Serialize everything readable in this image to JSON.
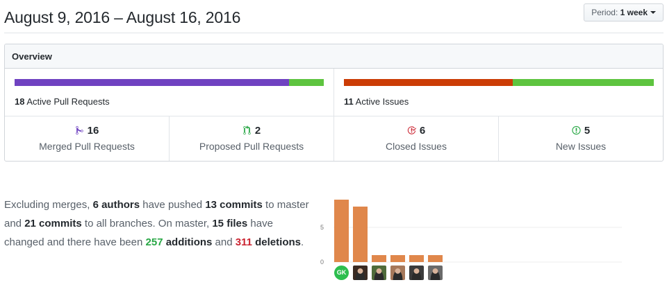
{
  "header": {
    "title": "August 9, 2016 – August 16, 2016",
    "period_prefix": "Period:",
    "period_value": "1 week"
  },
  "overview": {
    "title": "Overview",
    "pull_requests_bar": {
      "merged_fraction": 0.888,
      "color_merged": "#6f42c1",
      "color_open": "#5ec43f"
    },
    "issues_bar": {
      "closed_fraction": 0.545,
      "color_closed": "#cb3c05",
      "color_open": "#5ec43f"
    },
    "active_pull_requests": {
      "count": "18",
      "label": "Active Pull Requests"
    },
    "active_issues": {
      "count": "11",
      "label": "Active Issues"
    },
    "stats": [
      {
        "count": "16",
        "label": "Merged Pull Requests",
        "icon": "git-merge-icon",
        "icon_color": "#6f42c1"
      },
      {
        "count": "2",
        "label": "Proposed Pull Requests",
        "icon": "git-pull-request-icon",
        "icon_color": "#28a745"
      },
      {
        "count": "6",
        "label": "Closed Issues",
        "icon": "issue-closed-icon",
        "icon_color": "#cb2431"
      },
      {
        "count": "5",
        "label": "New Issues",
        "icon": "issue-opened-icon",
        "icon_color": "#28a745"
      }
    ]
  },
  "commit_summary": {
    "t1": "Excluding merges, ",
    "authors": "6 authors",
    "t2": " have pushed ",
    "commits_master": "13 commits",
    "t3": " to master and ",
    "commits_all": "21 commits",
    "t4": " to all branches. On master, ",
    "files": "15 files",
    "t5": " have changed and there have been ",
    "additions_count": "257",
    "additions_word": " additions",
    "t6": " and ",
    "deletions_count": "311",
    "deletions_word": " deletions",
    "t7": "."
  },
  "chart_data": {
    "type": "bar",
    "categories": [
      "GK",
      "author-2",
      "author-3",
      "author-4",
      "author-5",
      "author-6"
    ],
    "values": [
      9,
      8,
      1,
      1,
      1,
      1
    ],
    "ylim": [
      0,
      10
    ],
    "yticks": [
      "0",
      "5"
    ],
    "bar_color": "#e0874b",
    "grid": true
  },
  "contributors": [
    {
      "initials": "GK",
      "color": "#2cbe4e"
    },
    {
      "initials": "",
      "color": "#3a2a22"
    },
    {
      "initials": "",
      "color": "#4f6b3a"
    },
    {
      "initials": "",
      "color": "#a6785a"
    },
    {
      "initials": "",
      "color": "#3b3b3b"
    },
    {
      "initials": "",
      "color": "#6a6a6a"
    }
  ]
}
